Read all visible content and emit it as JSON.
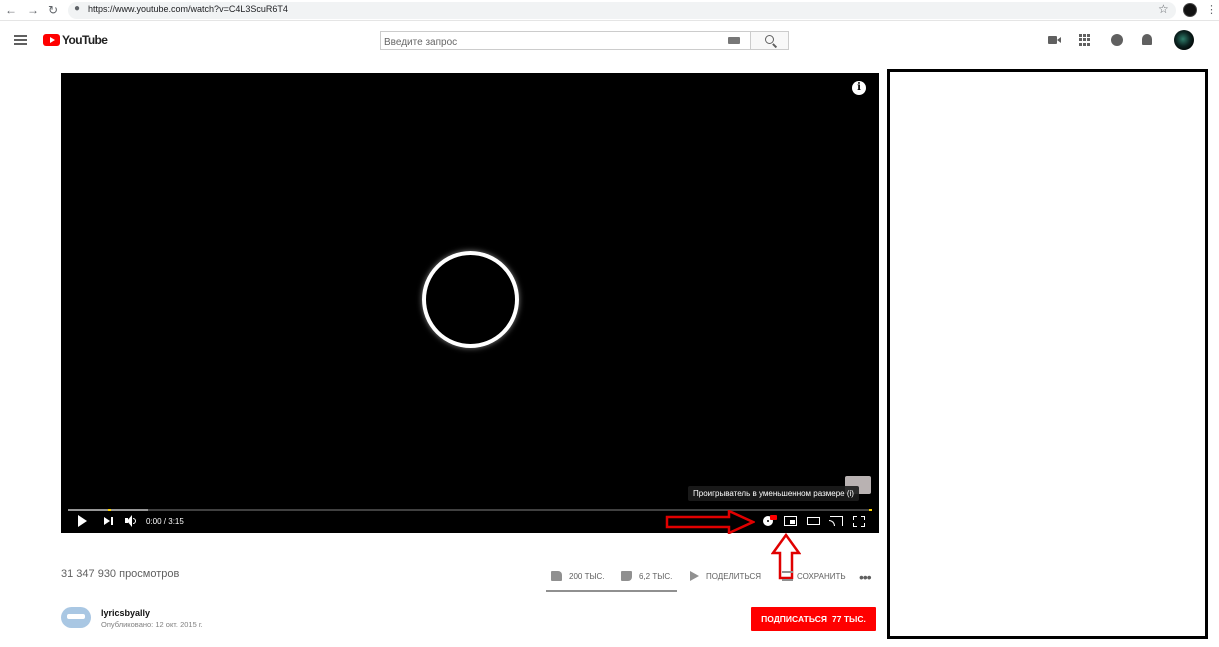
{
  "browser": {
    "url": "https://www.youtube.com/watch?v=C4L3ScuR6T4"
  },
  "header": {
    "logo_text": "YouTube",
    "search_placeholder": "Введите запрос"
  },
  "player": {
    "time": "0:00 / 3:15",
    "tooltip": "Проигрыватель в уменьшенном размере (i)",
    "info_glyph": "i",
    "progress_buffered": 0.1
  },
  "video": {
    "views": "31 347 930 просмотров",
    "likes": "200 ТЫС.",
    "dislikes": "6,2 ТЫС.",
    "share_label": "ПОДЕЛИТЬСЯ",
    "save_label": "СОХРАНИТЬ",
    "more_glyph": "•••"
  },
  "channel": {
    "name": "lyricsbyally",
    "published": "Опубликовано: 12 окт. 2015 г.",
    "subscribe_label": "ПОДПИСАТЬСЯ",
    "subscriber_count": "77 ТЫС."
  },
  "colors": {
    "brand_red": "#ff0000",
    "annotation_red": "#e00000"
  },
  "icons": [
    "back-icon",
    "forward-icon",
    "reload-icon",
    "lock-icon",
    "star-icon",
    "menu-icon",
    "keyboard-icon",
    "search-icon",
    "create-video-icon",
    "apps-icon",
    "messages-icon",
    "notifications-icon",
    "info-icon",
    "play-icon",
    "next-icon",
    "volume-icon",
    "settings-icon",
    "miniplayer-icon",
    "theater-icon",
    "cast-icon",
    "fullscreen-icon",
    "thumb-up-icon",
    "thumb-down-icon",
    "share-icon",
    "save-icon"
  ]
}
